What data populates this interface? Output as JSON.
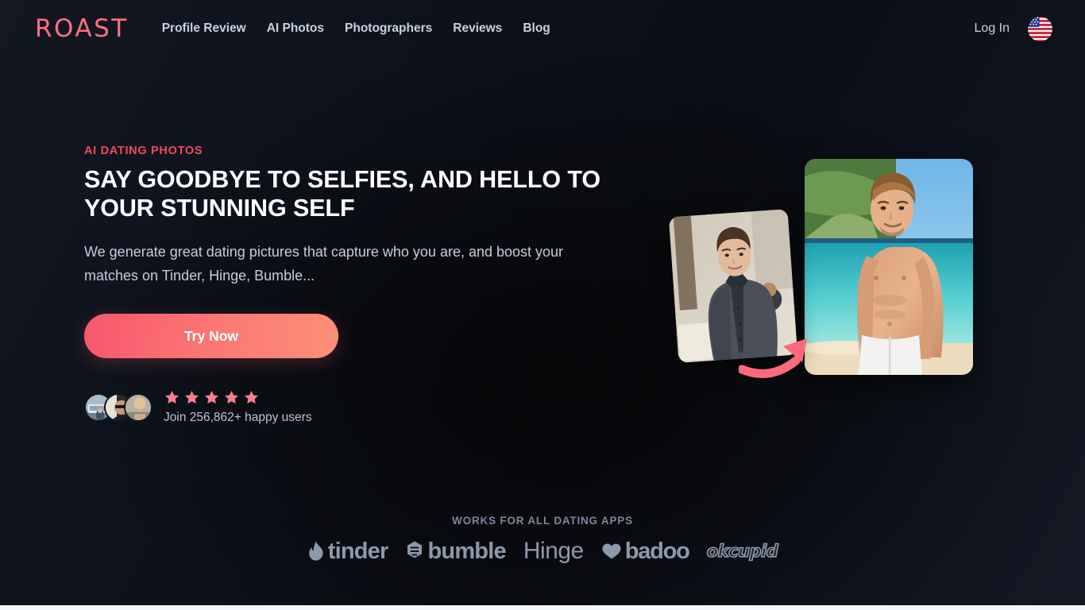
{
  "brand": {
    "logo_text": "ROAST"
  },
  "header": {
    "nav_links": [
      {
        "label": "Profile Review"
      },
      {
        "label": "AI Photos"
      },
      {
        "label": "Photographers"
      },
      {
        "label": "Reviews"
      },
      {
        "label": "Blog"
      }
    ],
    "login_label": "Log In",
    "locale_icon": "us-flag-icon"
  },
  "hero": {
    "eyebrow": "AI DATING PHOTOS",
    "headline": "SAY GOODBYE TO SELFIES, AND HELLO TO YOUR STUNNING SELF",
    "subhead": "We generate great dating pictures that capture who you are, and boost your matches on Tinder, Hinge, Bumble...",
    "cta_label": "Try Now",
    "social_proof": {
      "stars": 5,
      "join_text": "Join 256,862+ happy users",
      "avatar_count": 3
    },
    "media": {
      "before_alt": "man in grey shirt outdoors before photo",
      "after_alt": "shirtless man on tropical beach after photo",
      "arrow_icon": "curved-arrow-icon"
    }
  },
  "brands": {
    "label": "WORKS FOR ALL DATING APPS",
    "items": [
      {
        "name": "tinder",
        "icon": "tinder-flame-icon"
      },
      {
        "name": "bumble",
        "icon": "bumble-hexagon-icon"
      },
      {
        "name": "Hinge",
        "icon": ""
      },
      {
        "name": "badoo",
        "icon": "badoo-heart-icon"
      },
      {
        "name": "okcupid",
        "icon": ""
      }
    ]
  },
  "colors": {
    "accent_pink": "#f2485e",
    "logo_coral": "#ff7080",
    "cta_gradient_start": "#f8566d",
    "cta_gradient_end": "#fd8f78",
    "star": "#fa7f8e",
    "background": "#0b0e14",
    "nav_text": "#c6d2e2",
    "muted_text": "#7a8699"
  }
}
